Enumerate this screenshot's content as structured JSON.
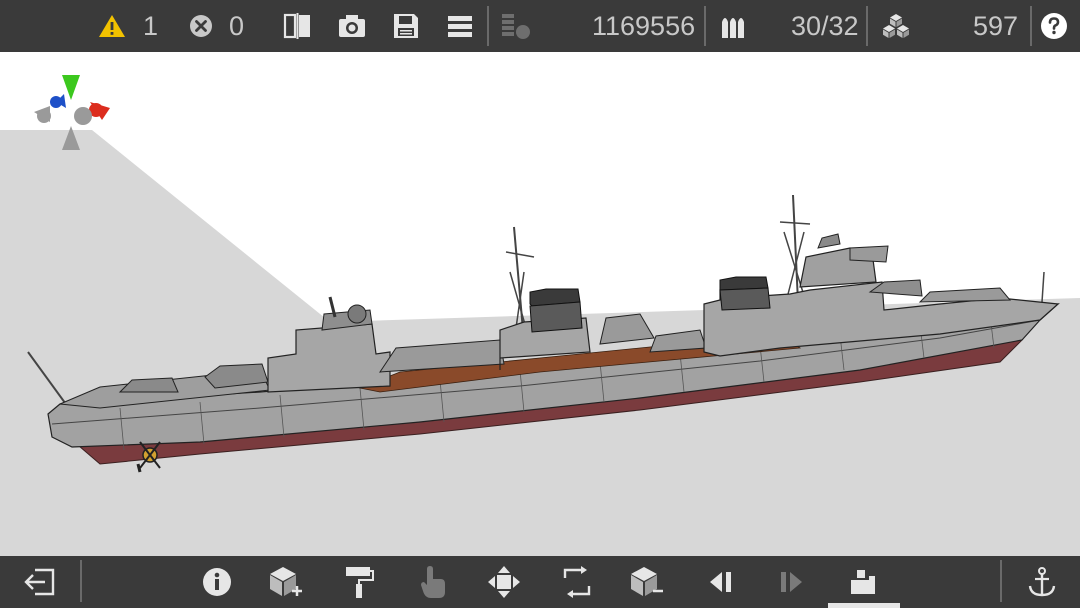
{
  "topbar": {
    "warnings_count": "1",
    "errors_count": "0",
    "cost_value": "1169556",
    "ammo_value": "30/32",
    "blocks_value": "597"
  },
  "colors": {
    "bar_bg": "#3a3a3a",
    "warning": "#f2c200",
    "hull_gray": "#9a9a9a",
    "hull_red": "#7a3b3e",
    "deck_brown": "#8a4a2a",
    "axis_green": "#3cc81e",
    "axis_red": "#dc2d1e",
    "axis_blue": "#1e50c8"
  },
  "icons": {
    "warning": "warning-triangle-icon",
    "error": "error-x-icon",
    "mirror": "mirror-icon",
    "camera": "camera-icon",
    "save": "save-disk-icon",
    "menu": "menu-icon",
    "cost": "cost-coins-icon",
    "ammo": "ammo-shells-icon",
    "blocks": "blocks-icon",
    "help": "help-icon",
    "exit": "exit-icon",
    "info": "info-icon",
    "add_block": "add-block-icon",
    "paint": "paint-roller-icon",
    "hand": "hand-select-icon",
    "move": "move-arrows-icon",
    "rotate": "rotate-icon",
    "remove_block": "remove-block-icon",
    "undo": "undo-icon",
    "redo": "redo-icon",
    "build_mode": "build-mode-icon",
    "anchor": "anchor-icon"
  }
}
